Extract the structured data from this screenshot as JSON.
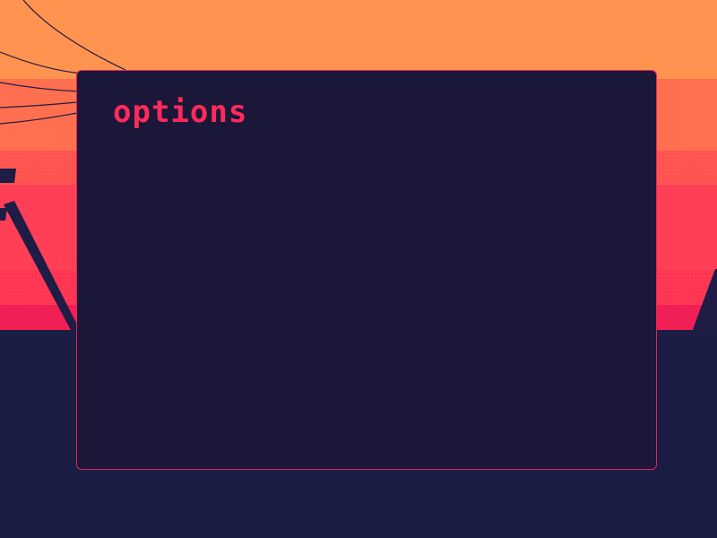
{
  "dialog": {
    "title": "options"
  },
  "colors": {
    "sky_top": "#ff934f",
    "sky_bottom": "#f01f55",
    "ground": "#1b1d45",
    "panel_background": "#1a1738",
    "panel_border": "#e4245a",
    "title_text": "#ff2a5c",
    "silhouette": "#1f1c46"
  },
  "icons": [
    "power-line-wires",
    "utility-pole-silhouette",
    "tower-silhouette"
  ]
}
